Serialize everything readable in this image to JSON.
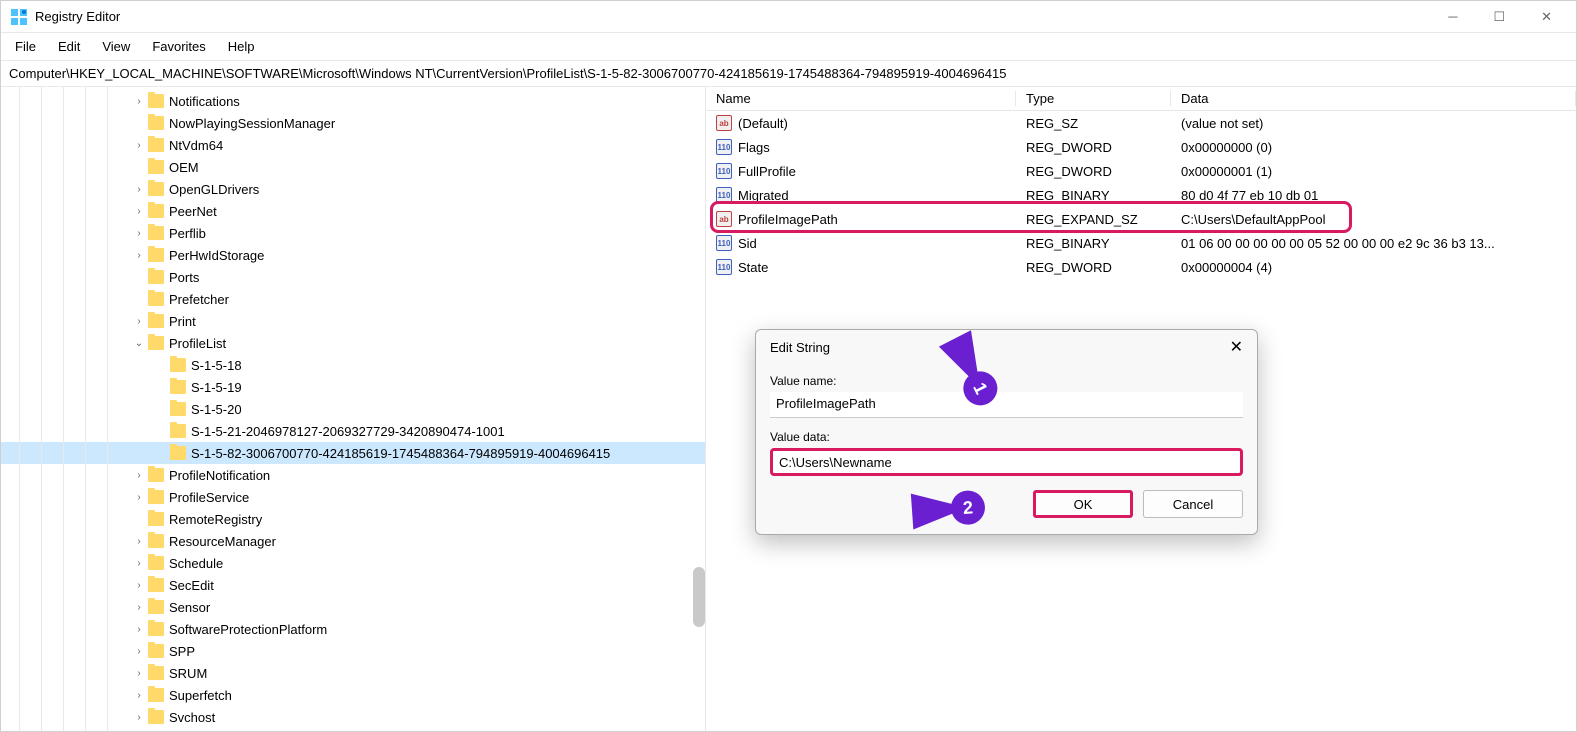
{
  "app": {
    "title": "Registry Editor"
  },
  "menu": {
    "file": "File",
    "edit": "Edit",
    "view": "View",
    "favorites": "Favorites",
    "help": "Help"
  },
  "address": "Computer\\HKEY_LOCAL_MACHINE\\SOFTWARE\\Microsoft\\Windows NT\\CurrentVersion\\ProfileList\\S-1-5-82-3006700770-424185619-1745488364-794895919-4004696415",
  "columns": {
    "name": "Name",
    "type": "Type",
    "data": "Data"
  },
  "tree": {
    "items": [
      {
        "label": "Notifications",
        "depth": 6,
        "exp": "closed"
      },
      {
        "label": "NowPlayingSessionManager",
        "depth": 6,
        "exp": "leaf"
      },
      {
        "label": "NtVdm64",
        "depth": 6,
        "exp": "closed"
      },
      {
        "label": "OEM",
        "depth": 6,
        "exp": "leaf"
      },
      {
        "label": "OpenGLDrivers",
        "depth": 6,
        "exp": "closed"
      },
      {
        "label": "PeerNet",
        "depth": 6,
        "exp": "closed"
      },
      {
        "label": "Perflib",
        "depth": 6,
        "exp": "closed"
      },
      {
        "label": "PerHwIdStorage",
        "depth": 6,
        "exp": "closed"
      },
      {
        "label": "Ports",
        "depth": 6,
        "exp": "leaf"
      },
      {
        "label": "Prefetcher",
        "depth": 6,
        "exp": "leaf"
      },
      {
        "label": "Print",
        "depth": 6,
        "exp": "closed"
      },
      {
        "label": "ProfileList",
        "depth": 6,
        "exp": "open"
      },
      {
        "label": "S-1-5-18",
        "depth": 7,
        "exp": "leaf"
      },
      {
        "label": "S-1-5-19",
        "depth": 7,
        "exp": "leaf"
      },
      {
        "label": "S-1-5-20",
        "depth": 7,
        "exp": "leaf"
      },
      {
        "label": "S-1-5-21-2046978127-2069327729-3420890474-1001",
        "depth": 7,
        "exp": "leaf"
      },
      {
        "label": "S-1-5-82-3006700770-424185619-1745488364-794895919-4004696415",
        "depth": 7,
        "exp": "leaf",
        "selected": true
      },
      {
        "label": "ProfileNotification",
        "depth": 6,
        "exp": "closed"
      },
      {
        "label": "ProfileService",
        "depth": 6,
        "exp": "closed"
      },
      {
        "label": "RemoteRegistry",
        "depth": 6,
        "exp": "leaf"
      },
      {
        "label": "ResourceManager",
        "depth": 6,
        "exp": "closed"
      },
      {
        "label": "Schedule",
        "depth": 6,
        "exp": "closed"
      },
      {
        "label": "SecEdit",
        "depth": 6,
        "exp": "closed"
      },
      {
        "label": "Sensor",
        "depth": 6,
        "exp": "closed"
      },
      {
        "label": "SoftwareProtectionPlatform",
        "depth": 6,
        "exp": "closed"
      },
      {
        "label": "SPP",
        "depth": 6,
        "exp": "closed"
      },
      {
        "label": "SRUM",
        "depth": 6,
        "exp": "closed"
      },
      {
        "label": "Superfetch",
        "depth": 6,
        "exp": "closed"
      },
      {
        "label": "Svchost",
        "depth": 6,
        "exp": "closed"
      }
    ]
  },
  "values": [
    {
      "icon": "sz",
      "name": "(Default)",
      "type": "REG_SZ",
      "data": "(value not set)"
    },
    {
      "icon": "dw",
      "name": "Flags",
      "type": "REG_DWORD",
      "data": "0x00000000 (0)"
    },
    {
      "icon": "dw",
      "name": "FullProfile",
      "type": "REG_DWORD",
      "data": "0x00000001 (1)"
    },
    {
      "icon": "dw",
      "name": "Migrated",
      "type": "REG_BINARY",
      "data": "80 d0 4f 77 eb 10 db 01"
    },
    {
      "icon": "sz",
      "name": "ProfileImagePath",
      "type": "REG_EXPAND_SZ",
      "data": "C:\\Users\\DefaultAppPool"
    },
    {
      "icon": "dw",
      "name": "Sid",
      "type": "REG_BINARY",
      "data": "01 06 00 00 00 00 00 05 52 00 00 00 e2 9c 36 b3 13..."
    },
    {
      "icon": "dw",
      "name": "State",
      "type": "REG_DWORD",
      "data": "0x00000004 (4)"
    }
  ],
  "dialog": {
    "title": "Edit String",
    "vname_label": "Value name:",
    "vname": "ProfileImagePath",
    "vdata_label": "Value data:",
    "vdata": "C:\\Users\\Newname",
    "ok": "OK",
    "cancel": "Cancel"
  },
  "annot": {
    "n1": "1",
    "n2": "2"
  }
}
